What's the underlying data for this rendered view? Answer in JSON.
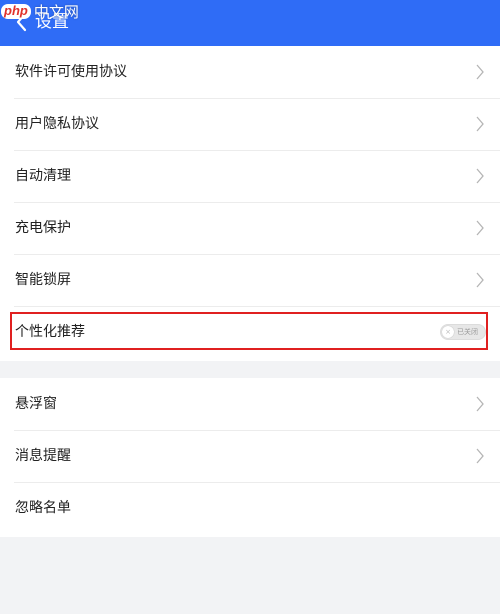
{
  "header": {
    "title": "设置",
    "back_icon": "chevron-left-icon",
    "background": "#2f6cf6"
  },
  "watermark": {
    "logo": "php",
    "text": "中文网"
  },
  "group1": {
    "items": [
      {
        "label": "软件许可使用协议"
      },
      {
        "label": "用户隐私协议"
      },
      {
        "label": "自动清理"
      },
      {
        "label": "充电保护"
      },
      {
        "label": "智能锁屏"
      }
    ],
    "toggle_item": {
      "label": "个性化推荐",
      "toggle_state": "已关闭",
      "enabled": false,
      "highlight_color": "#e02020"
    }
  },
  "group2": {
    "items": [
      {
        "label": "悬浮窗"
      },
      {
        "label": "消息提醒"
      },
      {
        "label": "忽略名单"
      }
    ]
  }
}
